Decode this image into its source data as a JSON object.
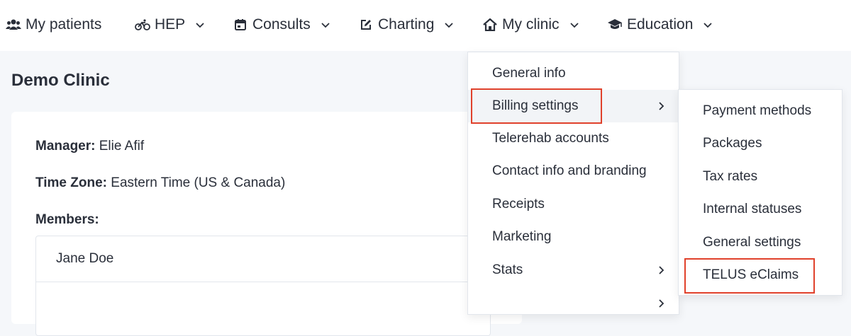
{
  "nav": {
    "items": [
      {
        "label": "My patients",
        "icon": "users-icon"
      },
      {
        "label": "HEP",
        "icon": "bicycle-icon"
      },
      {
        "label": "Consults",
        "icon": "calendar-icon"
      },
      {
        "label": "Charting",
        "icon": "edit-icon"
      },
      {
        "label": "My clinic",
        "icon": "home-icon"
      },
      {
        "label": "Education",
        "icon": "graduation-cap-icon"
      }
    ]
  },
  "page": {
    "title": "Demo Clinic",
    "manager_label": "Manager:",
    "manager_value": "Elie Afif",
    "timezone_label": "Time Zone:",
    "timezone_value": "Eastern Time (US & Canada)",
    "members_label": "Members:",
    "members": [
      "Jane Doe"
    ]
  },
  "clinic_menu": {
    "items": [
      {
        "label": "General info",
        "has_submenu": false
      },
      {
        "label": "Billing settings",
        "has_submenu": true,
        "active": true
      },
      {
        "label": "Telerehab accounts",
        "has_submenu": false
      },
      {
        "label": "Contact info and branding",
        "has_submenu": false
      },
      {
        "label": "Receipts",
        "has_submenu": false
      },
      {
        "label": "Marketing",
        "has_submenu": false
      },
      {
        "label": "Stats",
        "has_submenu": true
      }
    ]
  },
  "billing_submenu": {
    "items": [
      {
        "label": "Payment methods"
      },
      {
        "label": "Packages"
      },
      {
        "label": "Tax rates"
      },
      {
        "label": "Internal statuses"
      },
      {
        "label": "General settings"
      },
      {
        "label": "TELUS eClaims",
        "highlighted": true
      }
    ]
  },
  "colors": {
    "highlight": "#e0412b",
    "text": "#2a2f3a",
    "background": "#f5f7fa"
  }
}
